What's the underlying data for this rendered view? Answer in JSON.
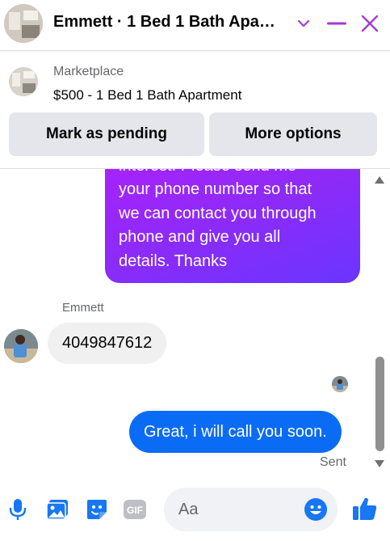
{
  "header": {
    "title": "Emmett · 1 Bed 1 Bath Apa…",
    "icons": [
      "chevron-down-icon",
      "minimize-icon",
      "close-icon"
    ],
    "accent_color": "#a33bd6"
  },
  "marketplace": {
    "label": "Marketplace",
    "listing_title": "$500 - 1 Bed 1 Bath Apartment",
    "buttons": {
      "mark_pending": "Mark as pending",
      "more_options": "More options"
    }
  },
  "messages": {
    "outgoing_partial": {
      "lines": [
        "interest. Please send me",
        "your phone number so that",
        "we can contact you through",
        "phone and give you all",
        "details. Thanks"
      ]
    },
    "incoming": {
      "sender": "Emmett",
      "text": "4049847612"
    },
    "outgoing_last": {
      "text": "Great, i will call you soon.",
      "status": "Sent",
      "color": "#0a6cf5"
    }
  },
  "composer": {
    "placeholder": "Aa",
    "icons": [
      "microphone-icon",
      "photo-icon",
      "sticker-icon",
      "gif-icon",
      "emoji-icon",
      "like-icon"
    ],
    "accent_color": "#1877f2"
  }
}
